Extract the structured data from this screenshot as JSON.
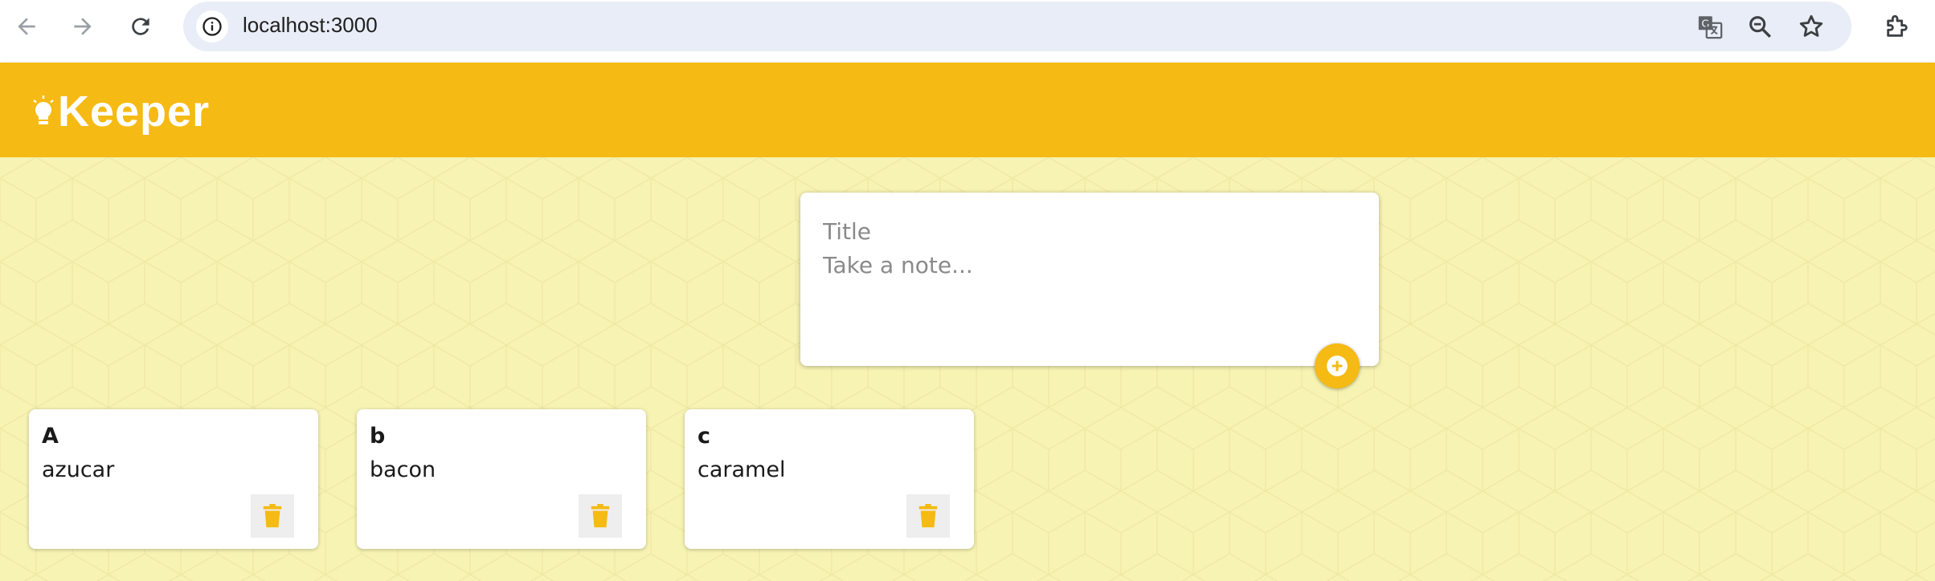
{
  "browser": {
    "url": "localhost:3000",
    "icons": {
      "back": "arrow-left-icon",
      "forward": "arrow-right-icon",
      "reload": "reload-icon",
      "site_info": "info-icon",
      "translate": "translate-icon",
      "zoom": "zoom-out-icon",
      "bookmark": "star-icon",
      "extensions": "puzzle-icon"
    }
  },
  "app": {
    "name": "Keeper",
    "brand_color": "#f5ba13",
    "background_color": "#f7f3b3"
  },
  "create_note": {
    "title_placeholder": "Title",
    "content_placeholder": "Take a note...",
    "add_icon": "plus-circle-icon"
  },
  "notes": [
    {
      "title": "A",
      "content": "azucar"
    },
    {
      "title": "b",
      "content": "bacon"
    },
    {
      "title": "c",
      "content": "caramel"
    }
  ]
}
